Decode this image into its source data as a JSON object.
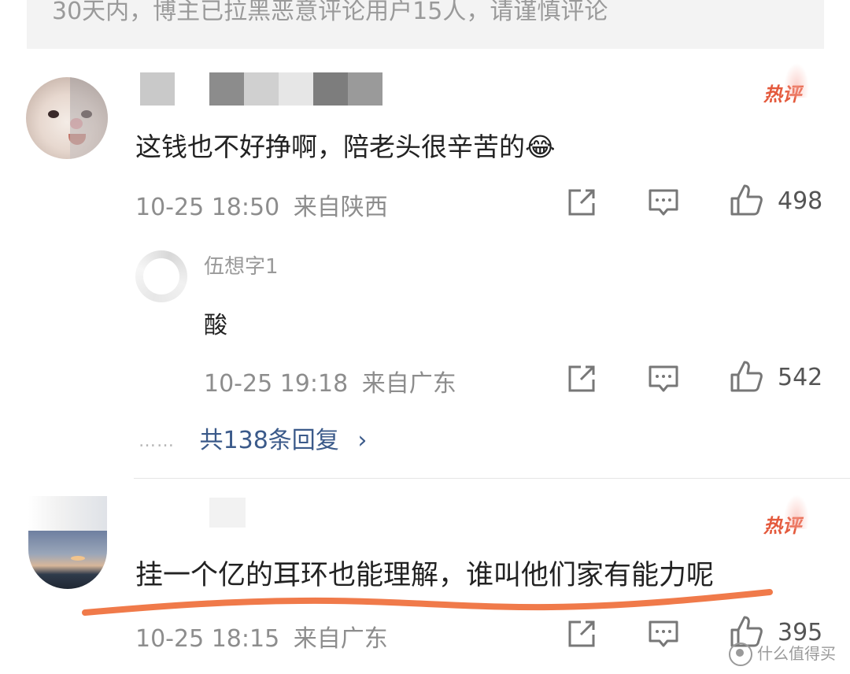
{
  "notice": {
    "text": "30天内，博主已拉黑恶意评论用户15人，请谨慎评论"
  },
  "comments": [
    {
      "author": "",
      "text": "这钱也不好挣啊，陪老头很辛苦的😂",
      "time": "10-25 18:50",
      "location": "来自陕西",
      "likes": "498",
      "hot_label": "热评"
    },
    {
      "author": "",
      "text": "挂一个亿的耳环也能理解，谁叫他们家有能力呢",
      "time": "10-25 18:15",
      "location": "来自广东",
      "likes": "395",
      "hot_label": "热评"
    }
  ],
  "reply": {
    "author": "伍想字1",
    "text": "酸",
    "time": "10-25 19:18",
    "location": "来自广东",
    "likes": "542"
  },
  "more_replies": {
    "dots": "……",
    "label": "共138条回复",
    "chevron": "›"
  },
  "icons": {
    "share": "share-icon",
    "comment": "comment-icon",
    "like": "thumbs-up-icon"
  },
  "watermark": {
    "text": "什么值得买"
  },
  "colors": {
    "hot": "#e45a3d",
    "link": "#3b5a8a",
    "meta": "#8d8d8d",
    "highlight": "#f07a4a"
  }
}
